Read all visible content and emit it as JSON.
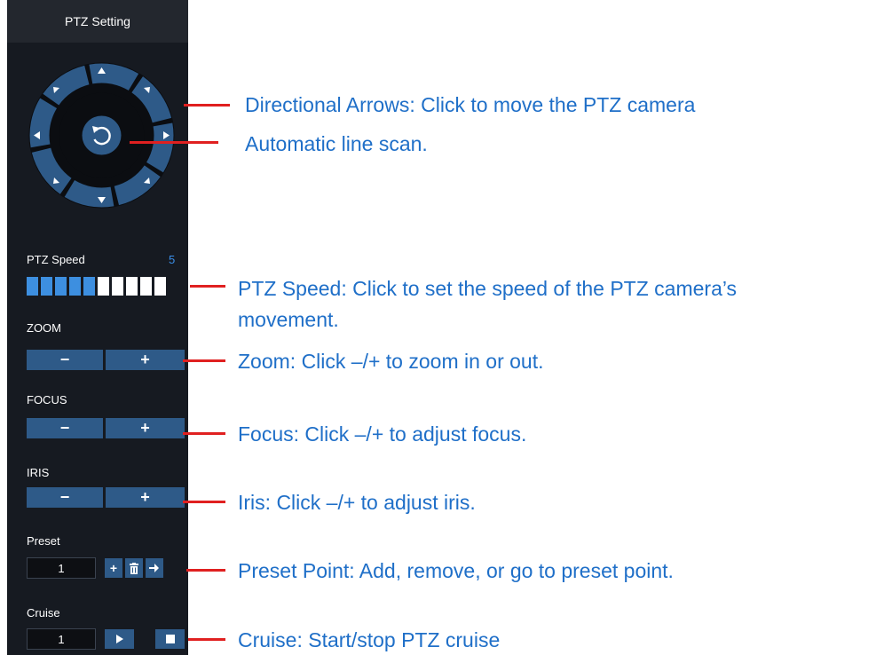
{
  "panel": {
    "title": "PTZ Setting",
    "speed_label": "PTZ Speed",
    "speed_value": "5",
    "speed_level": 5,
    "speed_max": 10,
    "zoom_label": "ZOOM",
    "focus_label": "FOCUS",
    "iris_label": "IRIS",
    "minus": "−",
    "plus": "+",
    "preset_label": "Preset",
    "preset_value": "1",
    "cruise_label": "Cruise",
    "cruise_value": "1"
  },
  "icons": {
    "dpad_up": "triangle-up-icon",
    "dpad_center": "rotate-scan-icon",
    "preset_add": "plus-icon",
    "preset_delete": "trash-icon",
    "preset_goto": "arrow-right-icon",
    "cruise_start": "play-icon",
    "cruise_stop": "stop-icon"
  },
  "colors": {
    "panel_bg": "#161a21",
    "button": "#2e5a88",
    "speed_active": "#3d8fe0",
    "annotation_text": "#1f6fc8",
    "annotation_line": "#e02020"
  },
  "annotations": {
    "directional": "Directional Arrows: Click to move the PTZ camera",
    "auto_scan": "Automatic line scan.",
    "speed_line1": "PTZ Speed: Click to set the speed of the PTZ camera’s",
    "speed_line2": "movement.",
    "zoom": "Zoom: Click –/+ to zoom in or out.",
    "focus": "Focus: Click –/+ to adjust focus.",
    "iris": "Iris: Click –/+ to adjust iris.",
    "preset": "Preset Point: Add, remove, or go to preset point.",
    "cruise": "Cruise: Start/stop PTZ cruise"
  }
}
